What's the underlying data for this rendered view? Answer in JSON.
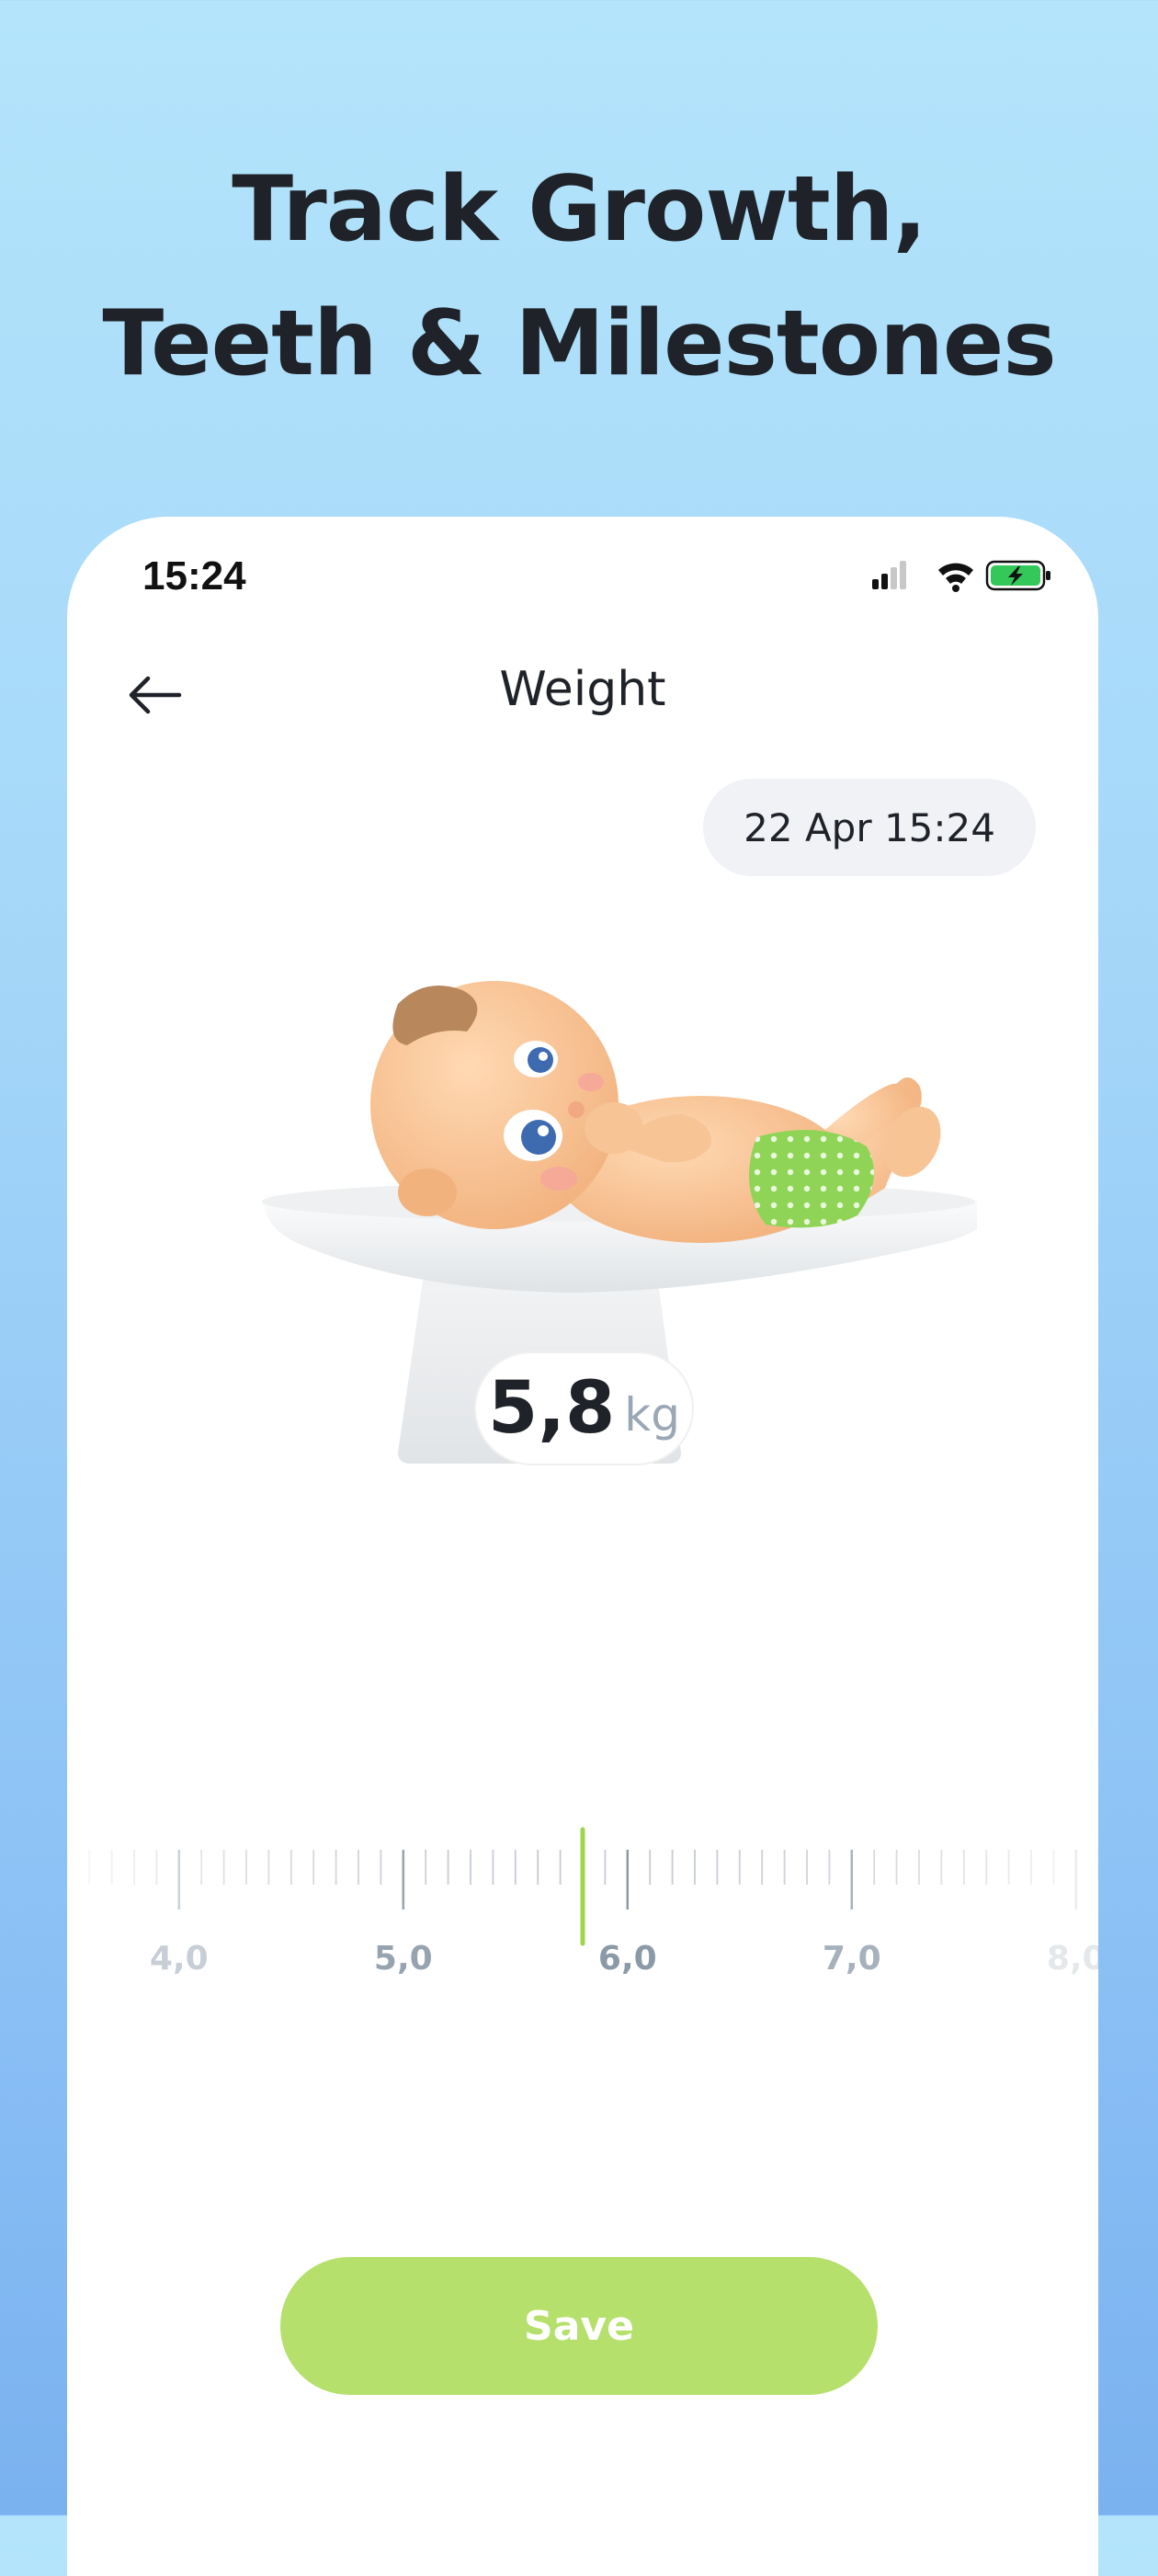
{
  "headline": {
    "line1": "Track Growth,",
    "line2": "Teeth & Milestones"
  },
  "status_bar": {
    "time": "15:24",
    "icons": [
      "cellular-signal-icon",
      "wifi-icon",
      "battery-charging-icon"
    ]
  },
  "nav": {
    "title": "Weight",
    "back_icon": "arrow-left-icon"
  },
  "date_selector": {
    "value": "22 Apr 15:24"
  },
  "scale": {
    "value": "5,8",
    "unit": "kg"
  },
  "ruler": {
    "labels": [
      "4,0",
      "5,0",
      "6,0",
      "7,0",
      "8,0"
    ],
    "selected_value": 5.8,
    "min": 4.0,
    "max": 8.0,
    "step": 0.1
  },
  "actions": {
    "save_label": "Save"
  },
  "colors": {
    "accent_green": "#b5e06c",
    "indicator_green": "#9fd44f",
    "tick_gray": "#c5ccd4",
    "label_gray": "#8c9aa8",
    "title_dark": "#1f2329"
  }
}
